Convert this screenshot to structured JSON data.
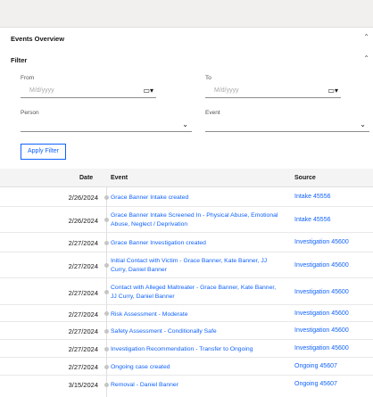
{
  "sections": {
    "overview_title": "Events Overview",
    "filter_title": "Filter"
  },
  "filter": {
    "from_label": "From",
    "to_label": "To",
    "from_placeholder": "M/d/yyyy",
    "to_placeholder": "M/d/yyyy",
    "person_label": "Person",
    "event_label": "Event",
    "apply_label": "Apply Filter"
  },
  "table": {
    "headers": {
      "date": "Date",
      "event": "Event",
      "source": "Source"
    },
    "rows": [
      {
        "date": "2/26/2024",
        "event": "Grace Banner Intake created",
        "source": "Intake 45556"
      },
      {
        "date": "2/26/2024",
        "event": "Grace Banner Intake Screened In - Physical Abuse, Emotional Abuse, Neglect / Deprivation",
        "source": "Intake 45556"
      },
      {
        "date": "2/27/2024",
        "event": "Grace Banner Investigation created",
        "source": "Investigation 45600"
      },
      {
        "date": "2/27/2024",
        "event": "Initial Contact with Victim - Grace Banner, Kate Banner, JJ Curry, Daniel Banner",
        "source": "Investigation 45600"
      },
      {
        "date": "2/27/2024",
        "event": "Contact with Alleged Maltreater - Grace Banner, Kate Banner, JJ Curry, Daniel Banner",
        "source": "Investigation 45600"
      },
      {
        "date": "2/27/2024",
        "event": "Risk Assessment - Moderate",
        "source": "Investigation 45600"
      },
      {
        "date": "2/27/2024",
        "event": "Safety Assessment - Conditionally Safe",
        "source": "Investigation 45600"
      },
      {
        "date": "2/27/2024",
        "event": "Investigation Recommendation - Transfer to Ongoing",
        "source": "Investigation 45600"
      },
      {
        "date": "2/27/2024",
        "event": "Ongoing case created",
        "source": "Ongoing 45607"
      },
      {
        "date": "3/15/2024",
        "event": "Removal - Daniel Banner",
        "source": "Ongoing 45607"
      }
    ]
  },
  "icons": {
    "calendar": "calendar-icon",
    "chevron": "chevron-down-icon",
    "collapse": "chevron-up-icon"
  },
  "colors": {
    "link": "#0f62fe",
    "header_bg": "#f4f4f4",
    "topbar_bg": "#f1f0ee"
  }
}
